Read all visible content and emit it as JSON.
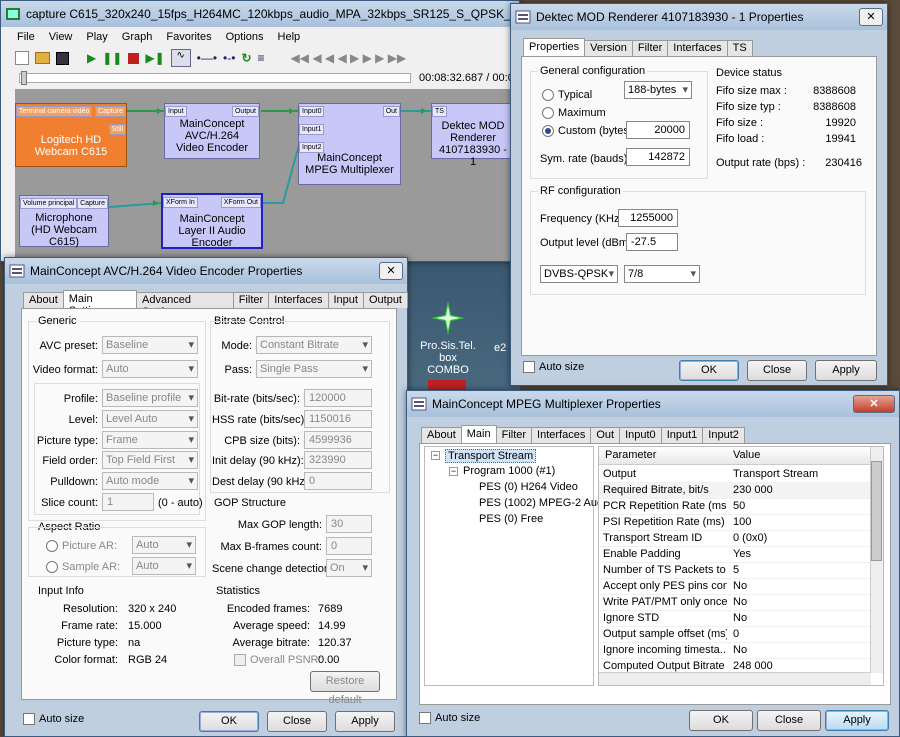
{
  "desktop": {
    "icon1": "Pro.Sis.Tel. box COMBO",
    "icon1_line2": "COMBO",
    "icon1_line1": "Pro.Sis.Tel. box",
    "partial": "e2"
  },
  "graphedit": {
    "title": "capture C615_320x240_15fps_H264MC_120kbps_audio_MPA_32kbps_SR125_S_QPSK_fec78_20...",
    "menu": [
      "File",
      "View",
      "Play",
      "Graph",
      "Favorites",
      "Options",
      "Help"
    ],
    "time": "00:08:32.687 / 00:0",
    "nodes": {
      "webcam": {
        "name": "Logitech HD Webcam C615",
        "pin_in": "Terminal caméra vidéo",
        "pin_cap": "Capture",
        "pin_still": "Still"
      },
      "h264": {
        "name": "MainConcept AVC/H.264 Video Encoder",
        "pin_in": "Input",
        "pin_out": "Output"
      },
      "mux": {
        "name": "MainConcept MPEG Multiplexer",
        "pins": [
          "Input0",
          "Input1",
          "Input2"
        ],
        "pin_out": "Out"
      },
      "dektec": {
        "name": "Dektec MOD Renderer 4107183930 - 1",
        "pin_in": "TS"
      },
      "mic": {
        "name": "Microphone (HD Webcam C615)",
        "pin_in": "Volume principal",
        "pin_cap": "Capture"
      },
      "layer2": {
        "name": "MainConcept Layer II Audio Encoder",
        "pin_in": "XForm In",
        "pin_out": "XForm Out"
      }
    }
  },
  "dektec": {
    "title": "Dektec MOD Renderer 4107183930 - 1 Properties",
    "tabs": [
      "Properties",
      "Version",
      "Filter",
      "Interfaces",
      "TS"
    ],
    "general": "General configuration",
    "typical": "Typical",
    "maximum": "Maximum",
    "custom": "Custom (bytes)",
    "typical_sel": "188-bytes",
    "custom_val": "20000",
    "sym_label": "Sym. rate (bauds)",
    "sym_val": "142872",
    "device_status": "Device status",
    "status": [
      {
        "k": "Fifo size max :",
        "v": "8388608"
      },
      {
        "k": "Fifo size typ :",
        "v": "8388608"
      },
      {
        "k": "Fifo size :",
        "v": "19920"
      },
      {
        "k": "Fifo load :",
        "v": "19941"
      }
    ],
    "output_rate_label": "Output rate (bps) :",
    "output_rate": "230416",
    "rf": "RF configuration",
    "freq_label": "Frequency (KHz) :",
    "freq": "1255000",
    "level_label": "Output level (dBm) :",
    "level": "-27.5",
    "mod": "DVBS-QPSK",
    "fec": "7/8",
    "autosize": "Auto size",
    "ok": "OK",
    "close": "Close",
    "apply": "Apply"
  },
  "avc": {
    "title": "MainConcept AVC/H.264 Video Encoder Properties",
    "tabs": [
      "About",
      "Main Settings",
      "Advanced Settings",
      "Filter",
      "Interfaces",
      "Input",
      "Output"
    ],
    "generic": "Generic",
    "avc_preset_l": "AVC preset:",
    "avc_preset": "Baseline",
    "video_format_l": "Video format:",
    "video_format": "Auto",
    "profile_l": "Profile:",
    "profile": "Baseline profile",
    "level_l": "Level:",
    "level": "Level Auto",
    "pic_type_l": "Picture type:",
    "pic_type": "Frame",
    "field_order_l": "Field order:",
    "field_order": "Top Field First",
    "pulldown_l": "Pulldown:",
    "pulldown": "Auto mode",
    "slice_l": "Slice count:",
    "slice": "1",
    "slice_hint": "(0 - auto)",
    "bitrate": "Bitrate Control",
    "mode_l": "Mode:",
    "mode": "Constant Bitrate",
    "pass_l": "Pass:",
    "pass": "Single Pass",
    "bitrate_l": "Bit-rate (bits/sec):",
    "bitrate_v": "120000",
    "hss_l": "HSS rate (bits/sec):",
    "hss": "1150016",
    "cpb_l": "CPB size (bits):",
    "cpb": "4599936",
    "init_l": "Init delay (90 kHz):",
    "init": "323990",
    "dest_l": "Dest delay (90 kHz):",
    "dest": "0",
    "gop": "GOP Structure",
    "gop_max_l": "Max GOP length:",
    "gop_max": "30",
    "bframes_l": "Max B-frames count:",
    "bframes": "0",
    "scene_l": "Scene change detection:",
    "scene": "On",
    "aspect": "Aspect Ratio",
    "pic_ar": "Picture AR:",
    "sample_ar": "Sample AR:",
    "ar_auto": "Auto",
    "input_info": "Input Info",
    "res_l": "Resolution:",
    "res": "320 x 240",
    "fr_l": "Frame rate:",
    "fr": "15.000",
    "pt_l": "Picture type:",
    "pt": "na",
    "cf_l": "Color format:",
    "cf": "RGB 24",
    "stats": "Statistics",
    "enc_l": "Encoded frames:",
    "enc": "7689",
    "spd_l": "Average speed:",
    "spd": "14.99",
    "abr_l": "Average bitrate:",
    "abr": "120.37",
    "psnr_l": "Overall PSNR:",
    "psnr": "0.00",
    "restore": "Restore default",
    "autosize": "Auto size",
    "ok": "OK",
    "close": "Close",
    "apply": "Apply"
  },
  "mux": {
    "title": "MainConcept MPEG Multiplexer Properties",
    "tabs": [
      "About",
      "Main",
      "Filter",
      "Interfaces",
      "Out",
      "Input0",
      "Input1",
      "Input2"
    ],
    "tree": [
      "Transport Stream",
      "Program 1000 (#1)",
      "PES (0) H264 Video",
      "PES (1002) MPEG-2 Audio",
      "PES (0) Free"
    ],
    "col_param": "Parameter",
    "col_value": "Value",
    "rows": [
      {
        "p": "Output",
        "v": "Transport Stream"
      },
      {
        "p": "Required Bitrate, bit/s",
        "v": "230 000"
      },
      {
        "p": "PCR Repetition Rate (ms)",
        "v": "50"
      },
      {
        "p": "PSI Repetition Rate (ms)",
        "v": "100"
      },
      {
        "p": "Transport Stream ID",
        "v": "0 (0x0)"
      },
      {
        "p": "Enable Padding",
        "v": "Yes"
      },
      {
        "p": "Number of TS Packets to ...",
        "v": "5"
      },
      {
        "p": "Accept only PES pins con...",
        "v": "No"
      },
      {
        "p": "Write PAT/PMT only once",
        "v": "No"
      },
      {
        "p": "Ignore STD",
        "v": "No"
      },
      {
        "p": "Output sample offset (ms)",
        "v": "0"
      },
      {
        "p": "Ignore incoming timesta...",
        "v": "No"
      },
      {
        "p": "Computed Output Bitrate",
        "v": "248 000"
      }
    ],
    "autosize": "Auto size",
    "ok": "OK",
    "close": "Close",
    "apply": "Apply"
  }
}
